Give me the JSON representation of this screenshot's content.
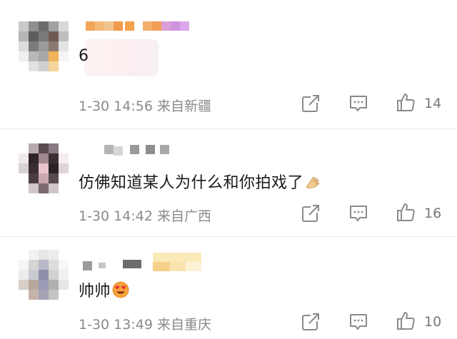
{
  "comments": [
    {
      "text": "6",
      "date": "1-30",
      "time": "14:56",
      "location": "来自新疆",
      "likes": "14"
    },
    {
      "text": "仿佛知道某人为什么和你拍戏了",
      "emoji": "hands-emoji",
      "date": "1-30",
      "time": "14:42",
      "location": "来自广西",
      "likes": "16"
    },
    {
      "text": "帅帅",
      "emoji": "heart-eyes-emoji",
      "date": "1-30",
      "time": "13:49",
      "location": "来自重庆",
      "likes": "10"
    }
  ],
  "icons": {
    "share": "share-icon",
    "comment": "comment-icon",
    "like": "thumbs-up-icon"
  },
  "colors": {
    "text": "#1a1a1a",
    "meta": "#8a8a8a",
    "icon": "#888888",
    "divider": "#ececec"
  }
}
